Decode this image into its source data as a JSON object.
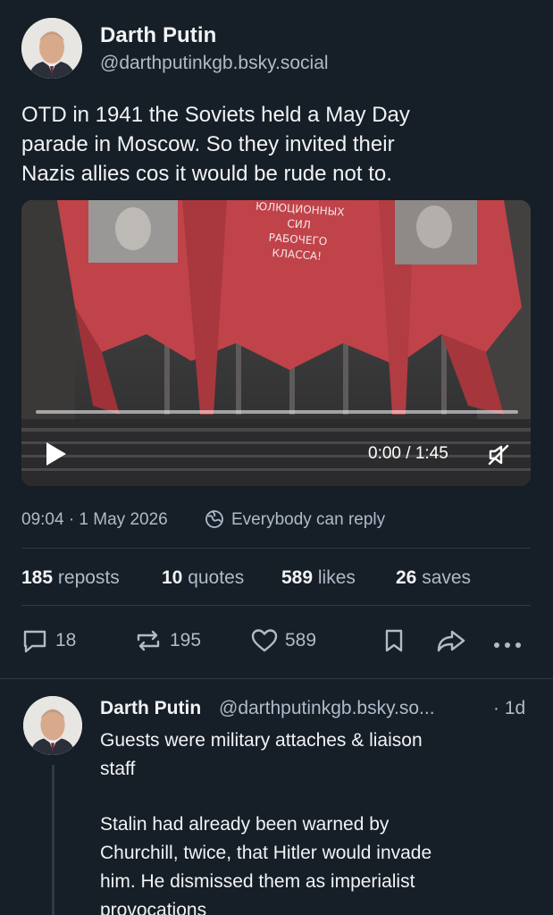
{
  "post": {
    "author_name": "Darth Putin",
    "author_handle": "@darthputinkgb.bsky.social",
    "text_lines": [
      "OTD in 1941 the Soviets held a May Day",
      "parade in Moscow. So they invited their",
      "Nazis allies cos it would be rude not to."
    ],
    "video": {
      "time": "0:00 / 1:45",
      "banner_lines": [
        "ЮЛЮЦИОННЫХ",
        "СИЛ",
        "РАБОЧЕГО",
        "КЛАССА!"
      ]
    },
    "timestamp": "09:04 · 1 May 2026",
    "reply_setting": "Everybody can reply",
    "stats": {
      "reposts_count": "185",
      "reposts_label": "reposts",
      "quotes_count": "10",
      "quotes_label": "quotes",
      "likes_count": "589",
      "likes_label": "likes",
      "saves_count": "26",
      "saves_label": "saves"
    },
    "actions": {
      "reply_count": "18",
      "repost_count": "195",
      "like_count": "589"
    }
  },
  "reply": {
    "author_name": "Darth Putin",
    "author_handle": "@darthputinkgb.bsky.so...",
    "age": "· 1d",
    "text_lines_1": [
      "Guests were military attaches & liaison",
      "staff"
    ],
    "text_lines_2": [
      "Stalin had already been warned by",
      "Churchill, twice, that Hitler would invade",
      "him. He dismissed them as imperialist",
      "provocations"
    ]
  },
  "icons": {
    "globe": "globe-icon",
    "reply": "speech-bubble-icon",
    "repost": "repost-arrows-icon",
    "like": "heart-icon",
    "save": "bookmark-icon",
    "share": "share-arrow-icon",
    "more": "ellipsis-icon",
    "play": "play-icon",
    "mute": "mute-icon"
  },
  "colors": {
    "background": "#161e27",
    "text": "#f1f3f5",
    "muted": "#aebbc9",
    "divider": "#2e3a47",
    "banner_red": "#c0434a"
  }
}
